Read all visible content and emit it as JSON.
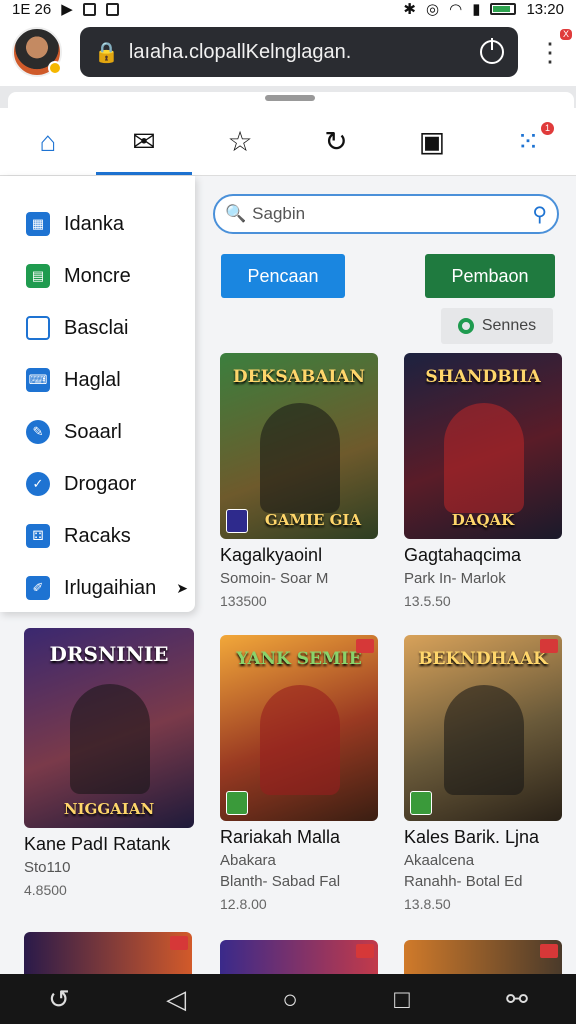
{
  "status_bar": {
    "time_left": "1E 26",
    "time_right": "13:20"
  },
  "browser": {
    "url": "laıaha.clopallKelnglagan.",
    "tab_badge": "X"
  },
  "tabs": [
    {
      "name": "home",
      "icon": "home-icon"
    },
    {
      "name": "mail",
      "icon": "mail-icon"
    },
    {
      "name": "explore",
      "icon": "star-outline-icon"
    },
    {
      "name": "refresh",
      "icon": "refresh-icon"
    },
    {
      "name": "game",
      "icon": "gamepad-icon"
    },
    {
      "name": "apps",
      "icon": "apps-grid-icon",
      "badge": "1"
    }
  ],
  "sidebar": {
    "items": [
      {
        "label": "Idanka",
        "icon": "calendar-icon",
        "color": "#1e73d2"
      },
      {
        "label": "Moncre",
        "icon": "chat-square-icon",
        "color": "#1f9b4f"
      },
      {
        "label": "Basclai",
        "icon": "square-icon",
        "color": "#1e73d2"
      },
      {
        "label": "Haglal",
        "icon": "keyboard-icon",
        "color": "#1e73d2"
      },
      {
        "label": "Soaarl",
        "icon": "pencil-icon",
        "color": "#1e73d2"
      },
      {
        "label": "Drogaor",
        "icon": "check-circle-icon",
        "color": "#1e73d2"
      },
      {
        "label": "Racaks",
        "icon": "dice-icon",
        "color": "#1e73d2"
      },
      {
        "label": "Irlugaihian",
        "icon": "edit-icon",
        "color": "#1e73d2"
      }
    ]
  },
  "search": {
    "placeholder": "Sagbin"
  },
  "actions": {
    "primary": "Pencaan",
    "secondary": "Pembaon",
    "sort": "Sennes"
  },
  "games_top": [
    {
      "title": "Kagalkyaoinl",
      "subtitle": "Somoin- Soar M",
      "price": "133500",
      "cover_top": "DEKSABAIAN",
      "cover_bottom": "GAMIE GIA"
    },
    {
      "title": "Gagtahaqcima",
      "subtitle": "Park In- Marlok",
      "price": "13.5.50",
      "cover_top": "SHANDBIIA",
      "cover_bottom": "DAQAK"
    }
  ],
  "games_bottom": [
    {
      "title": "Kane PadI Ratank",
      "subtitle": "Sto110",
      "price": "4.8500",
      "cover_top": "DRSNINIE",
      "cover_bottom": "NIGGAIAN"
    },
    {
      "title": "Rariakah Malla",
      "subtitle": "Abakara",
      "sub2": "Blanth- Sabad Fal",
      "price": "12.8.00",
      "cover_top": "YANK SEMIE",
      "cover_bottom": ""
    },
    {
      "title": "Kales Barik. Ljna",
      "subtitle": "Akaalcena",
      "sub2": "Ranahh- Botal Ed",
      "price": "13.8.50",
      "cover_top": "BEKNDHAAK",
      "cover_bottom": ""
    }
  ],
  "nav": {
    "back": "back-icon",
    "home": "home-circle-icon",
    "recent": "recent-square-icon"
  }
}
